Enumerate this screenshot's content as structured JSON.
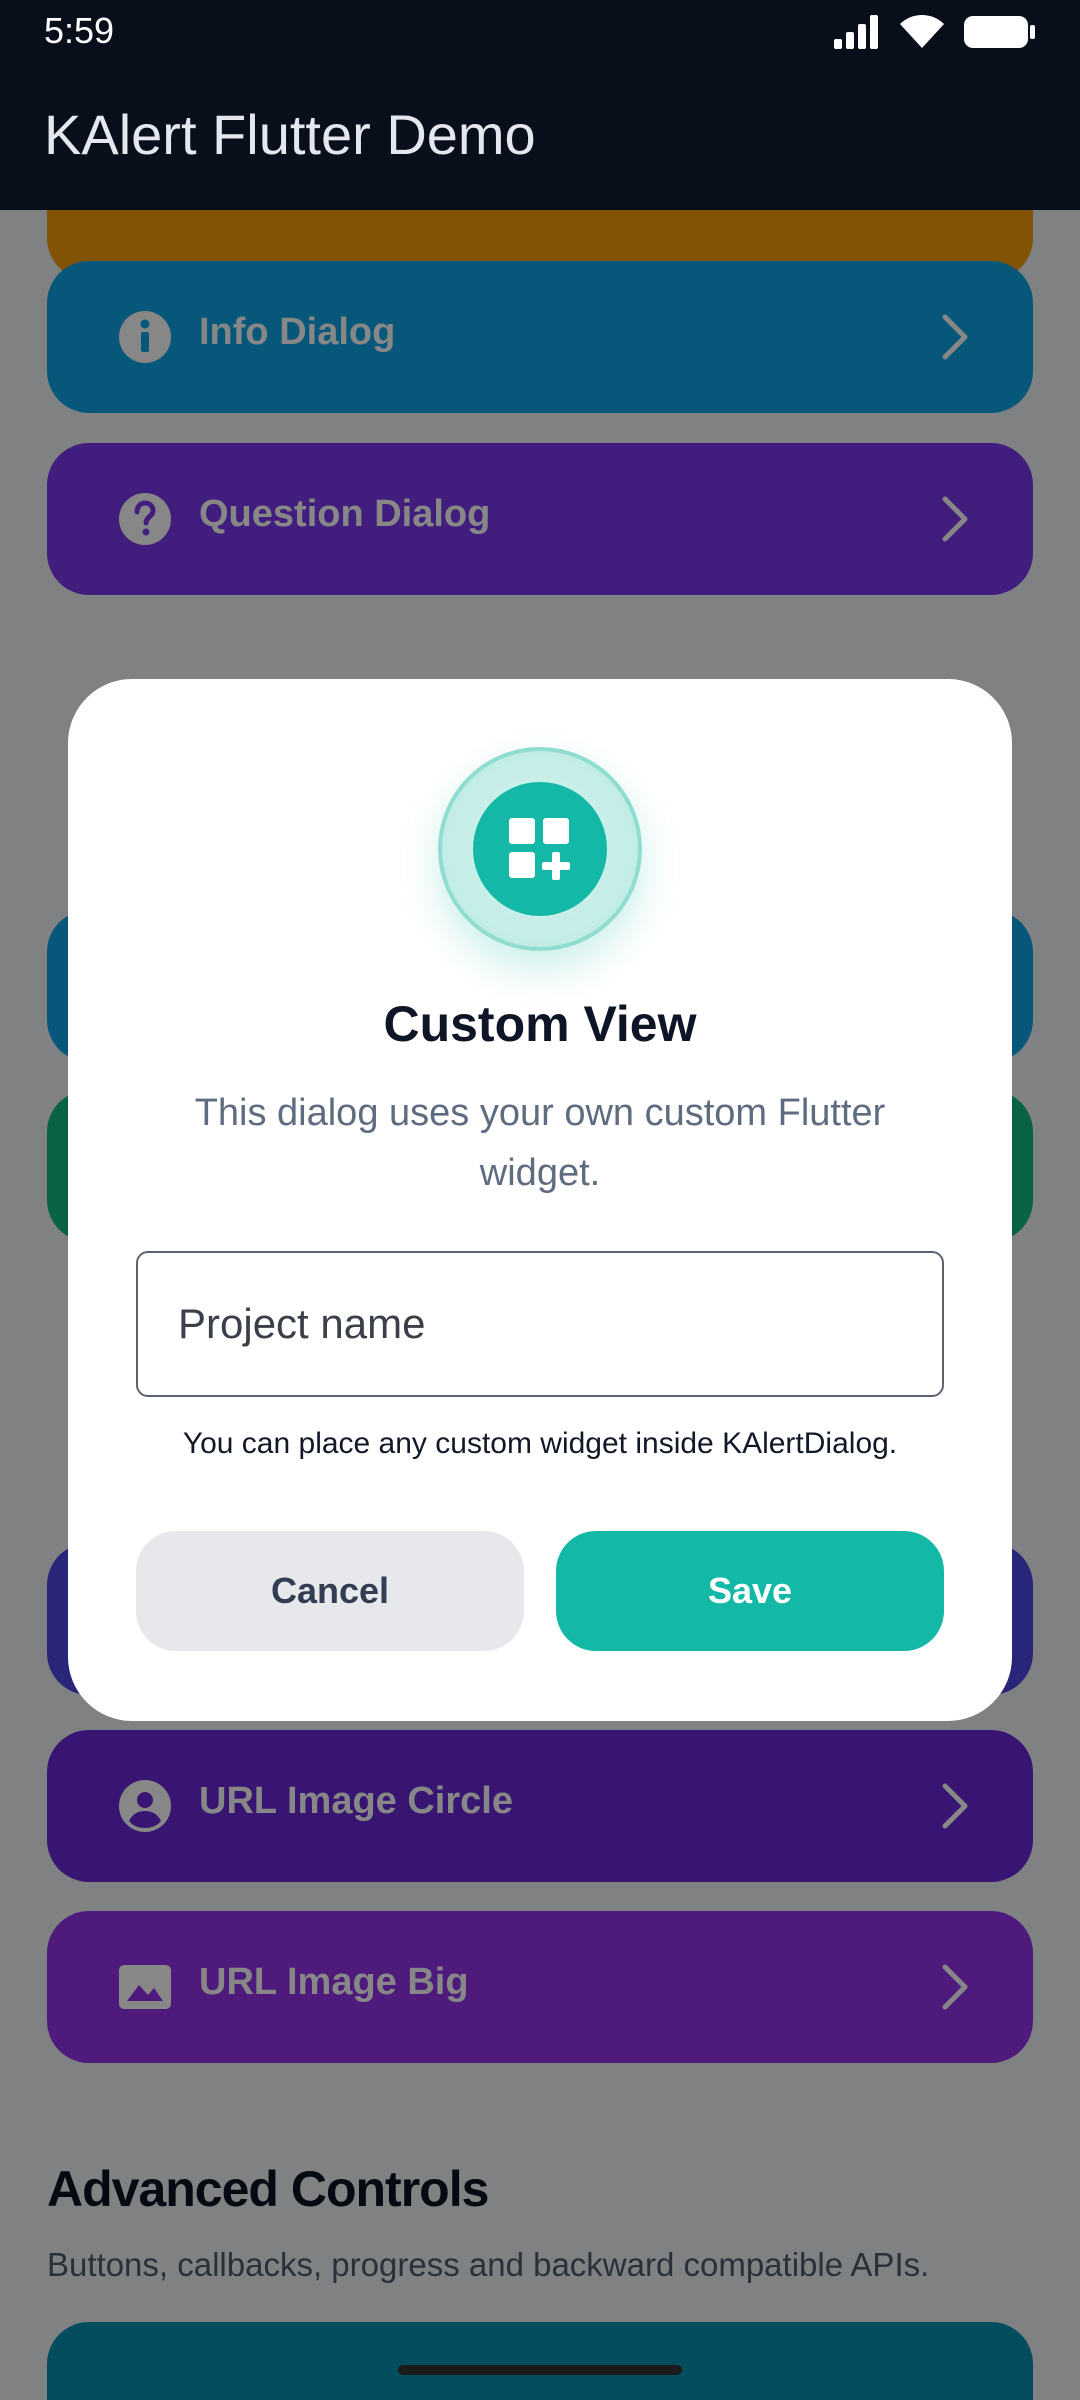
{
  "status_bar": {
    "time": "5:59"
  },
  "app_bar": {
    "title": "KAlert Flutter Demo"
  },
  "cards": [
    {
      "label": "Info Dialog",
      "icon": "info-icon",
      "color": "#0ea5e9"
    },
    {
      "label": "Question Dialog",
      "icon": "help-icon",
      "color": "#7c3aed"
    },
    {
      "label": "URL Image Circle",
      "icon": "account-circle-icon",
      "color": "#6d28d9"
    },
    {
      "label": "URL Image Big",
      "icon": "image-icon",
      "color": "#9333ea"
    }
  ],
  "sections": {
    "advanced": {
      "title": "Advanced Controls",
      "subtitle": "Buttons, callbacks, progress and backward compatible APIs."
    }
  },
  "dialog": {
    "icon": "widgets-add-icon",
    "title": "Custom View",
    "message": "This dialog uses your own custom Flutter widget.",
    "input_placeholder": "Project name",
    "input_value": "",
    "helper": "You can place any custom widget inside KAlertDialog.",
    "cancel_label": "Cancel",
    "save_label": "Save",
    "accent_color": "#14b8a6"
  }
}
